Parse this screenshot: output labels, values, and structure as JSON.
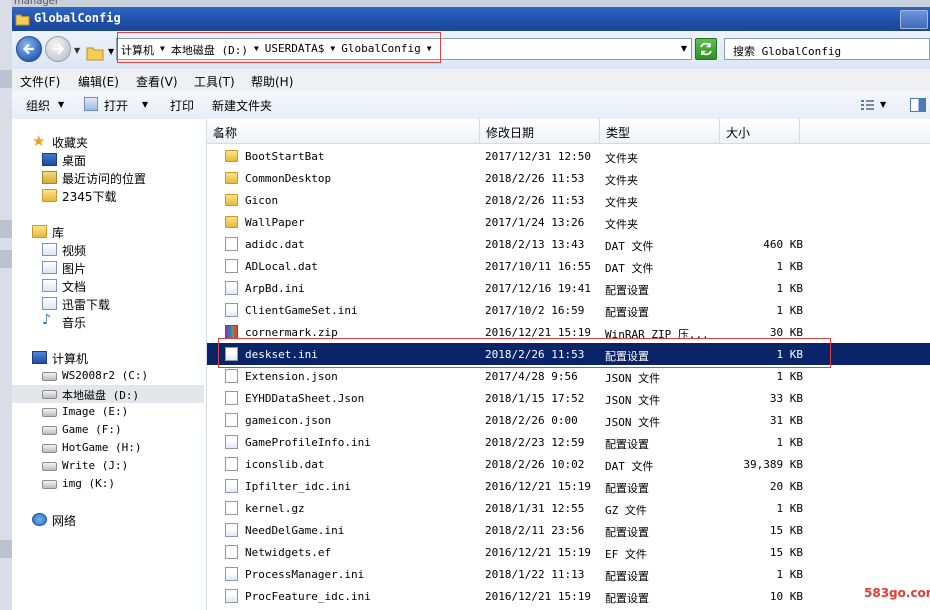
{
  "window": {
    "title": "GlobalConfig",
    "background_app_title": "manager"
  },
  "address_bar": {
    "crumbs": [
      "计算机",
      "本地磁盘 (D:)",
      "USERDATA$",
      "GlobalConfig"
    ]
  },
  "search": {
    "placeholder": "搜索 GlobalConfig"
  },
  "menu": {
    "items": [
      "文件(F)",
      "编辑(E)",
      "查看(V)",
      "工具(T)",
      "帮助(H)"
    ]
  },
  "toolbar": {
    "organize": "组织",
    "open": "打开",
    "print": "打印",
    "new_folder": "新建文件夹"
  },
  "nav": {
    "favorites": "收藏夹",
    "desktop": "桌面",
    "recent": "最近访问的位置",
    "dl2345": "2345下载",
    "libraries": "库",
    "videos": "视频",
    "pictures": "图片",
    "documents": "文档",
    "xunlei": "迅雷下载",
    "music": "音乐",
    "computer": "计算机",
    "drives": [
      "WS2008r2 (C:)",
      "本地磁盘 (D:)",
      "Image (E:)",
      "Game (F:)",
      "HotGame (H:)",
      "Write (J:)",
      "img (K:)"
    ],
    "network": "网络"
  },
  "columns": {
    "name": "名称",
    "date": "修改日期",
    "type": "类型",
    "size": "大小"
  },
  "files": [
    {
      "name": "BootStartBat",
      "date": "2017/12/31 12:50",
      "type": "文件夹",
      "size": "",
      "icon": "folder-icon"
    },
    {
      "name": "CommonDesktop",
      "date": "2018/2/26 11:53",
      "type": "文件夹",
      "size": "",
      "icon": "folder-icon"
    },
    {
      "name": "Gicon",
      "date": "2018/2/26 11:53",
      "type": "文件夹",
      "size": "",
      "icon": "folder-icon"
    },
    {
      "name": "WallPaper",
      "date": "2017/1/24 13:26",
      "type": "文件夹",
      "size": "",
      "icon": "folder-icon"
    },
    {
      "name": "adidc.dat",
      "date": "2018/2/13 13:43",
      "type": "DAT 文件",
      "size": "460 KB",
      "icon": "document-icon"
    },
    {
      "name": "ADLocal.dat",
      "date": "2017/10/11 16:55",
      "type": "DAT 文件",
      "size": "1 KB",
      "icon": "document-icon"
    },
    {
      "name": "ArpBd.ini",
      "date": "2017/12/16 19:41",
      "type": "配置设置",
      "size": "1 KB",
      "icon": "config-icon"
    },
    {
      "name": "ClientGameSet.ini",
      "date": "2017/10/2 16:59",
      "type": "配置设置",
      "size": "1 KB",
      "icon": "config-icon"
    },
    {
      "name": "cornermark.zip",
      "date": "2016/12/21 15:19",
      "type": "WinRAR ZIP 压...",
      "size": "30 KB",
      "icon": "winrar-icon"
    },
    {
      "name": "deskset.ini",
      "date": "2018/2/26 11:53",
      "type": "配置设置",
      "size": "1 KB",
      "icon": "config-icon",
      "selected": true
    },
    {
      "name": "Extension.json",
      "date": "2017/4/28 9:56",
      "type": "JSON 文件",
      "size": "1 KB",
      "icon": "document-icon"
    },
    {
      "name": "EYHDDataSheet.Json",
      "date": "2018/1/15 17:52",
      "type": "JSON 文件",
      "size": "33 KB",
      "icon": "document-icon"
    },
    {
      "name": "gameicon.json",
      "date": "2018/2/26 0:00",
      "type": "JSON 文件",
      "size": "31 KB",
      "icon": "document-icon"
    },
    {
      "name": "GameProfileInfo.ini",
      "date": "2018/2/23 12:59",
      "type": "配置设置",
      "size": "1 KB",
      "icon": "config-icon"
    },
    {
      "name": "iconslib.dat",
      "date": "2018/2/26 10:02",
      "type": "DAT 文件",
      "size": "39,389 KB",
      "icon": "document-icon"
    },
    {
      "name": "Ipfilter_idc.ini",
      "date": "2016/12/21 15:19",
      "type": "配置设置",
      "size": "20 KB",
      "icon": "config-icon"
    },
    {
      "name": "kernel.gz",
      "date": "2018/1/31 12:55",
      "type": "GZ 文件",
      "size": "1 KB",
      "icon": "document-icon"
    },
    {
      "name": "NeedDelGame.ini",
      "date": "2018/2/11 23:56",
      "type": "配置设置",
      "size": "15 KB",
      "icon": "config-icon"
    },
    {
      "name": "Netwidgets.ef",
      "date": "2016/12/21 15:19",
      "type": "EF 文件",
      "size": "15 KB",
      "icon": "document-icon"
    },
    {
      "name": "ProcessManager.ini",
      "date": "2018/1/22 11:13",
      "type": "配置设置",
      "size": "1 KB",
      "icon": "config-icon"
    },
    {
      "name": "ProcFeature_idc.ini",
      "date": "2016/12/21 15:19",
      "type": "配置设置",
      "size": "10 KB",
      "icon": "config-icon"
    }
  ],
  "watermark": "583go.com",
  "colors": {
    "selection": "#0a246a",
    "highlight_box": "#e14040",
    "titlebar": "#1f4fa6"
  }
}
